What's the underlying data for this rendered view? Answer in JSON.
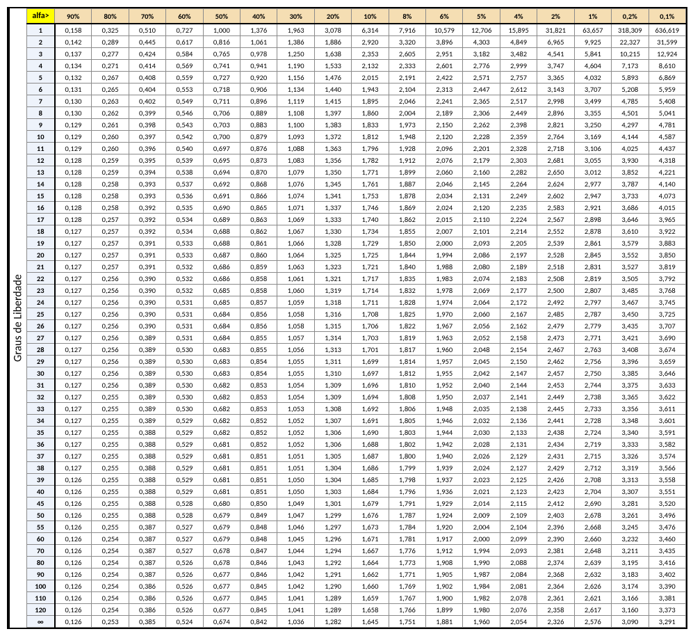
{
  "sideLabel": "Graus de Liberdade",
  "cornerLabel": "alfa>",
  "columns": [
    "90%",
    "80%",
    "70%",
    "60%",
    "50%",
    "40%",
    "30%",
    "20%",
    "10%",
    "8%",
    "6%",
    "5%",
    "4%",
    "2%",
    "1%",
    "0,2%",
    "0,1%"
  ],
  "rows": [
    {
      "h": "1",
      "v": [
        "0,158",
        "0,325",
        "0,510",
        "0,727",
        "1,000",
        "1,376",
        "1,963",
        "3,078",
        "6,314",
        "7,916",
        "10,579",
        "12,706",
        "15,895",
        "31,821",
        "63,657",
        "318,309",
        "636,619"
      ]
    },
    {
      "h": "2",
      "v": [
        "0,142",
        "0,289",
        "0,445",
        "0,617",
        "0,816",
        "1,061",
        "1,386",
        "1,886",
        "2,920",
        "3,320",
        "3,896",
        "4,303",
        "4,849",
        "6,965",
        "9,925",
        "22,327",
        "31,599"
      ]
    },
    {
      "h": "3",
      "v": [
        "0,137",
        "0,277",
        "0,424",
        "0,584",
        "0,765",
        "0,978",
        "1,250",
        "1,638",
        "2,353",
        "2,605",
        "2,951",
        "3,182",
        "3,482",
        "4,541",
        "5,841",
        "10,215",
        "12,924"
      ]
    },
    {
      "h": "4",
      "v": [
        "0,134",
        "0,271",
        "0,414",
        "0,569",
        "0,741",
        "0,941",
        "1,190",
        "1,533",
        "2,132",
        "2,333",
        "2,601",
        "2,776",
        "2,999",
        "3,747",
        "4,604",
        "7,173",
        "8,610"
      ]
    },
    {
      "h": "5",
      "v": [
        "0,132",
        "0,267",
        "0,408",
        "0,559",
        "0,727",
        "0,920",
        "1,156",
        "1,476",
        "2,015",
        "2,191",
        "2,422",
        "2,571",
        "2,757",
        "3,365",
        "4,032",
        "5,893",
        "6,869"
      ]
    },
    {
      "h": "6",
      "v": [
        "0,131",
        "0,265",
        "0,404",
        "0,553",
        "0,718",
        "0,906",
        "1,134",
        "1,440",
        "1,943",
        "2,104",
        "2,313",
        "2,447",
        "2,612",
        "3,143",
        "3,707",
        "5,208",
        "5,959"
      ]
    },
    {
      "h": "7",
      "v": [
        "0,130",
        "0,263",
        "0,402",
        "0,549",
        "0,711",
        "0,896",
        "1,119",
        "1,415",
        "1,895",
        "2,046",
        "2,241",
        "2,365",
        "2,517",
        "2,998",
        "3,499",
        "4,785",
        "5,408"
      ]
    },
    {
      "h": "8",
      "v": [
        "0,130",
        "0,262",
        "0,399",
        "0,546",
        "0,706",
        "0,889",
        "1,108",
        "1,397",
        "1,860",
        "2,004",
        "2,189",
        "2,306",
        "2,449",
        "2,896",
        "3,355",
        "4,501",
        "5,041"
      ]
    },
    {
      "h": "9",
      "v": [
        "0,129",
        "0,261",
        "0,398",
        "0,543",
        "0,703",
        "0,883",
        "1,100",
        "1,383",
        "1,833",
        "1,973",
        "2,150",
        "2,262",
        "2,398",
        "2,821",
        "3,250",
        "4,297",
        "4,781"
      ]
    },
    {
      "h": "10",
      "v": [
        "0,129",
        "0,260",
        "0,397",
        "0,542",
        "0,700",
        "0,879",
        "1,093",
        "1,372",
        "1,812",
        "1,948",
        "2,120",
        "2,228",
        "2,359",
        "2,764",
        "3,169",
        "4,144",
        "4,587"
      ]
    },
    {
      "h": "11",
      "v": [
        "0,129",
        "0,260",
        "0,396",
        "0,540",
        "0,697",
        "0,876",
        "1,088",
        "1,363",
        "1,796",
        "1,928",
        "2,096",
        "2,201",
        "2,328",
        "2,718",
        "3,106",
        "4,025",
        "4,437"
      ]
    },
    {
      "h": "12",
      "v": [
        "0,128",
        "0,259",
        "0,395",
        "0,539",
        "0,695",
        "0,873",
        "1,083",
        "1,356",
        "1,782",
        "1,912",
        "2,076",
        "2,179",
        "2,303",
        "2,681",
        "3,055",
        "3,930",
        "4,318"
      ]
    },
    {
      "h": "13",
      "v": [
        "0,128",
        "0,259",
        "0,394",
        "0,538",
        "0,694",
        "0,870",
        "1,079",
        "1,350",
        "1,771",
        "1,899",
        "2,060",
        "2,160",
        "2,282",
        "2,650",
        "3,012",
        "3,852",
        "4,221"
      ]
    },
    {
      "h": "14",
      "v": [
        "0,128",
        "0,258",
        "0,393",
        "0,537",
        "0,692",
        "0,868",
        "1,076",
        "1,345",
        "1,761",
        "1,887",
        "2,046",
        "2,145",
        "2,264",
        "2,624",
        "2,977",
        "3,787",
        "4,140"
      ]
    },
    {
      "h": "15",
      "v": [
        "0,128",
        "0,258",
        "0,393",
        "0,536",
        "0,691",
        "0,866",
        "1,074",
        "1,341",
        "1,753",
        "1,878",
        "2,034",
        "2,131",
        "2,249",
        "2,602",
        "2,947",
        "3,733",
        "4,073"
      ]
    },
    {
      "h": "16",
      "v": [
        "0,128",
        "0,258",
        "0,392",
        "0,535",
        "0,690",
        "0,865",
        "1,071",
        "1,337",
        "1,746",
        "1,869",
        "2,024",
        "2,120",
        "2,235",
        "2,583",
        "2,921",
        "3,686",
        "4,015"
      ]
    },
    {
      "h": "17",
      "v": [
        "0,128",
        "0,257",
        "0,392",
        "0,534",
        "0,689",
        "0,863",
        "1,069",
        "1,333",
        "1,740",
        "1,862",
        "2,015",
        "2,110",
        "2,224",
        "2,567",
        "2,898",
        "3,646",
        "3,965"
      ]
    },
    {
      "h": "18",
      "v": [
        "0,127",
        "0,257",
        "0,392",
        "0,534",
        "0,688",
        "0,862",
        "1,067",
        "1,330",
        "1,734",
        "1,855",
        "2,007",
        "2,101",
        "2,214",
        "2,552",
        "2,878",
        "3,610",
        "3,922"
      ]
    },
    {
      "h": "19",
      "v": [
        "0,127",
        "0,257",
        "0,391",
        "0,533",
        "0,688",
        "0,861",
        "1,066",
        "1,328",
        "1,729",
        "1,850",
        "2,000",
        "2,093",
        "2,205",
        "2,539",
        "2,861",
        "3,579",
        "3,883"
      ]
    },
    {
      "h": "20",
      "v": [
        "0,127",
        "0,257",
        "0,391",
        "0,533",
        "0,687",
        "0,860",
        "1,064",
        "1,325",
        "1,725",
        "1,844",
        "1,994",
        "2,086",
        "2,197",
        "2,528",
        "2,845",
        "3,552",
        "3,850"
      ]
    },
    {
      "h": "21",
      "v": [
        "0,127",
        "0,257",
        "0,391",
        "0,532",
        "0,686",
        "0,859",
        "1,063",
        "1,323",
        "1,721",
        "1,840",
        "1,988",
        "2,080",
        "2,189",
        "2,518",
        "2,831",
        "3,527",
        "3,819"
      ]
    },
    {
      "h": "22",
      "v": [
        "0,127",
        "0,256",
        "0,390",
        "0,532",
        "0,686",
        "0,858",
        "1,061",
        "1,321",
        "1,717",
        "1,835",
        "1,983",
        "2,074",
        "2,183",
        "2,508",
        "2,819",
        "3,505",
        "3,792"
      ]
    },
    {
      "h": "23",
      "v": [
        "0,127",
        "0,256",
        "0,390",
        "0,532",
        "0,685",
        "0,858",
        "1,060",
        "1,319",
        "1,714",
        "1,832",
        "1,978",
        "2,069",
        "2,177",
        "2,500",
        "2,807",
        "3,485",
        "3,768"
      ]
    },
    {
      "h": "24",
      "v": [
        "0,127",
        "0,256",
        "0,390",
        "0,531",
        "0,685",
        "0,857",
        "1,059",
        "1,318",
        "1,711",
        "1,828",
        "1,974",
        "2,064",
        "2,172",
        "2,492",
        "2,797",
        "3,467",
        "3,745"
      ]
    },
    {
      "h": "25",
      "v": [
        "0,127",
        "0,256",
        "0,390",
        "0,531",
        "0,684",
        "0,856",
        "1,058",
        "1,316",
        "1,708",
        "1,825",
        "1,970",
        "2,060",
        "2,167",
        "2,485",
        "2,787",
        "3,450",
        "3,725"
      ]
    },
    {
      "h": "26",
      "v": [
        "0,127",
        "0,256",
        "0,390",
        "0,531",
        "0,684",
        "0,856",
        "1,058",
        "1,315",
        "1,706",
        "1,822",
        "1,967",
        "2,056",
        "2,162",
        "2,479",
        "2,779",
        "3,435",
        "3,707"
      ]
    },
    {
      "h": "27",
      "v": [
        "0,127",
        "0,256",
        "0,389",
        "0,531",
        "0,684",
        "0,855",
        "1,057",
        "1,314",
        "1,703",
        "1,819",
        "1,963",
        "2,052",
        "2,158",
        "2,473",
        "2,771",
        "3,421",
        "3,690"
      ]
    },
    {
      "h": "28",
      "v": [
        "0,127",
        "0,256",
        "0,389",
        "0,530",
        "0,683",
        "0,855",
        "1,056",
        "1,313",
        "1,701",
        "1,817",
        "1,960",
        "2,048",
        "2,154",
        "2,467",
        "2,763",
        "3,408",
        "3,674"
      ]
    },
    {
      "h": "29",
      "v": [
        "0,127",
        "0,256",
        "0,389",
        "0,530",
        "0,683",
        "0,854",
        "1,055",
        "1,311",
        "1,699",
        "1,814",
        "1,957",
        "2,045",
        "2,150",
        "2,462",
        "2,756",
        "3,396",
        "3,659"
      ]
    },
    {
      "h": "30",
      "v": [
        "0,127",
        "0,256",
        "0,389",
        "0,530",
        "0,683",
        "0,854",
        "1,055",
        "1,310",
        "1,697",
        "1,812",
        "1,955",
        "2,042",
        "2,147",
        "2,457",
        "2,750",
        "3,385",
        "3,646"
      ]
    },
    {
      "h": "31",
      "v": [
        "0,127",
        "0,256",
        "0,389",
        "0,530",
        "0,682",
        "0,853",
        "1,054",
        "1,309",
        "1,696",
        "1,810",
        "1,952",
        "2,040",
        "2,144",
        "2,453",
        "2,744",
        "3,375",
        "3,633"
      ]
    },
    {
      "h": "32",
      "v": [
        "0,127",
        "0,255",
        "0,389",
        "0,530",
        "0,682",
        "0,853",
        "1,054",
        "1,309",
        "1,694",
        "1,808",
        "1,950",
        "2,037",
        "2,141",
        "2,449",
        "2,738",
        "3,365",
        "3,622"
      ]
    },
    {
      "h": "33",
      "v": [
        "0,127",
        "0,255",
        "0,389",
        "0,530",
        "0,682",
        "0,853",
        "1,053",
        "1,308",
        "1,692",
        "1,806",
        "1,948",
        "2,035",
        "2,138",
        "2,445",
        "2,733",
        "3,356",
        "3,611"
      ]
    },
    {
      "h": "34",
      "v": [
        "0,127",
        "0,255",
        "0,389",
        "0,529",
        "0,682",
        "0,852",
        "1,052",
        "1,307",
        "1,691",
        "1,805",
        "1,946",
        "2,032",
        "2,136",
        "2,441",
        "2,728",
        "3,348",
        "3,601"
      ]
    },
    {
      "h": "35",
      "v": [
        "0,127",
        "0,255",
        "0,388",
        "0,529",
        "0,682",
        "0,852",
        "1,052",
        "1,306",
        "1,690",
        "1,803",
        "1,944",
        "2,030",
        "2,133",
        "2,438",
        "2,724",
        "3,340",
        "3,591"
      ]
    },
    {
      "h": "36",
      "v": [
        "0,127",
        "0,255",
        "0,388",
        "0,529",
        "0,681",
        "0,852",
        "1,052",
        "1,306",
        "1,688",
        "1,802",
        "1,942",
        "2,028",
        "2,131",
        "2,434",
        "2,719",
        "3,333",
        "3,582"
      ]
    },
    {
      "h": "37",
      "v": [
        "0,127",
        "0,255",
        "0,388",
        "0,529",
        "0,681",
        "0,851",
        "1,051",
        "1,305",
        "1,687",
        "1,800",
        "1,940",
        "2,026",
        "2,129",
        "2,431",
        "2,715",
        "3,326",
        "3,574"
      ]
    },
    {
      "h": "38",
      "v": [
        "0,127",
        "0,255",
        "0,388",
        "0,529",
        "0,681",
        "0,851",
        "1,051",
        "1,304",
        "1,686",
        "1,799",
        "1,939",
        "2,024",
        "2,127",
        "2,429",
        "2,712",
        "3,319",
        "3,566"
      ]
    },
    {
      "h": "39",
      "v": [
        "0,126",
        "0,255",
        "0,388",
        "0,529",
        "0,681",
        "0,851",
        "1,050",
        "1,304",
        "1,685",
        "1,798",
        "1,937",
        "2,023",
        "2,125",
        "2,426",
        "2,708",
        "3,313",
        "3,558"
      ]
    },
    {
      "h": "40",
      "v": [
        "0,126",
        "0,255",
        "0,388",
        "0,529",
        "0,681",
        "0,851",
        "1,050",
        "1,303",
        "1,684",
        "1,796",
        "1,936",
        "2,021",
        "2,123",
        "2,423",
        "2,704",
        "3,307",
        "3,551"
      ]
    },
    {
      "h": "45",
      "v": [
        "0,126",
        "0,255",
        "0,388",
        "0,528",
        "0,680",
        "0,850",
        "1,049",
        "1,301",
        "1,679",
        "1,791",
        "1,929",
        "2,014",
        "2,115",
        "2,412",
        "2,690",
        "3,281",
        "3,520"
      ]
    },
    {
      "h": "50",
      "v": [
        "0,126",
        "0,255",
        "0,388",
        "0,528",
        "0,679",
        "0,849",
        "1,047",
        "1,299",
        "1,676",
        "1,787",
        "1,924",
        "2,009",
        "2,109",
        "2,403",
        "2,678",
        "3,261",
        "3,496"
      ]
    },
    {
      "h": "55",
      "v": [
        "0,126",
        "0,255",
        "0,387",
        "0,527",
        "0,679",
        "0,848",
        "1,046",
        "1,297",
        "1,673",
        "1,784",
        "1,920",
        "2,004",
        "2,104",
        "2,396",
        "2,668",
        "3,245",
        "3,476"
      ]
    },
    {
      "h": "60",
      "v": [
        "0,126",
        "0,254",
        "0,387",
        "0,527",
        "0,679",
        "0,848",
        "1,045",
        "1,296",
        "1,671",
        "1,781",
        "1,917",
        "2,000",
        "2,099",
        "2,390",
        "2,660",
        "3,232",
        "3,460"
      ]
    },
    {
      "h": "70",
      "v": [
        "0,126",
        "0,254",
        "0,387",
        "0,527",
        "0,678",
        "0,847",
        "1,044",
        "1,294",
        "1,667",
        "1,776",
        "1,912",
        "1,994",
        "2,093",
        "2,381",
        "2,648",
        "3,211",
        "3,435"
      ]
    },
    {
      "h": "80",
      "v": [
        "0,126",
        "0,254",
        "0,387",
        "0,526",
        "0,678",
        "0,846",
        "1,043",
        "1,292",
        "1,664",
        "1,773",
        "1,908",
        "1,990",
        "2,088",
        "2,374",
        "2,639",
        "3,195",
        "3,416"
      ]
    },
    {
      "h": "90",
      "v": [
        "0,126",
        "0,254",
        "0,387",
        "0,526",
        "0,677",
        "0,846",
        "1,042",
        "1,291",
        "1,662",
        "1,771",
        "1,905",
        "1,987",
        "2,084",
        "2,368",
        "2,632",
        "3,183",
        "3,402"
      ]
    },
    {
      "h": "100",
      "v": [
        "0,126",
        "0,254",
        "0,386",
        "0,526",
        "0,677",
        "0,845",
        "1,042",
        "1,290",
        "1,660",
        "1,769",
        "1,902",
        "1,984",
        "2,081",
        "2,364",
        "2,626",
        "3,174",
        "3,390"
      ]
    },
    {
      "h": "110",
      "v": [
        "0,126",
        "0,254",
        "0,386",
        "0,526",
        "0,677",
        "0,845",
        "1,041",
        "1,289",
        "1,659",
        "1,767",
        "1,900",
        "1,982",
        "2,078",
        "2,361",
        "2,621",
        "3,166",
        "3,381"
      ]
    },
    {
      "h": "120",
      "v": [
        "0,126",
        "0,254",
        "0,386",
        "0,526",
        "0,677",
        "0,845",
        "1,041",
        "1,289",
        "1,658",
        "1,766",
        "1,899",
        "1,980",
        "2,076",
        "2,358",
        "2,617",
        "3,160",
        "3,373"
      ]
    },
    {
      "h": "∞",
      "v": [
        "0,126",
        "0,253",
        "0,385",
        "0,524",
        "0,674",
        "0,842",
        "1,036",
        "1,282",
        "1,645",
        "1,751",
        "1,881",
        "1,960",
        "2,054",
        "2,326",
        "2,576",
        "3,090",
        "3,291"
      ]
    }
  ]
}
